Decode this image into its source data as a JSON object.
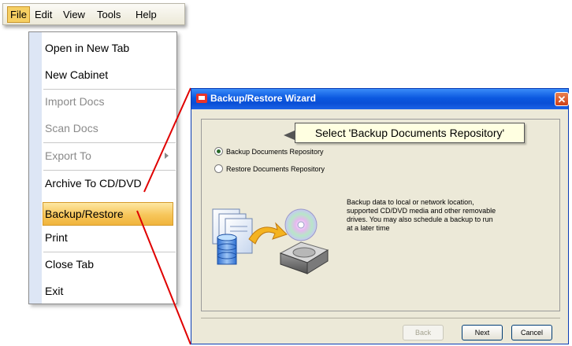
{
  "menubar": {
    "items": [
      "File",
      "Edit",
      "View",
      "Tools",
      "Help"
    ],
    "active": "File"
  },
  "file_menu": {
    "items": [
      {
        "label": "Open in New Tab",
        "enabled": true
      },
      {
        "label": "New Cabinet",
        "enabled": true
      },
      {
        "label": "Import Docs",
        "enabled": false
      },
      {
        "label": "Scan Docs",
        "enabled": false
      },
      {
        "label": "Export To",
        "enabled": false,
        "submenu": true
      },
      {
        "label": "Archive To CD/DVD",
        "enabled": true
      },
      {
        "label": "Backup/Restore",
        "enabled": true,
        "highlighted": true
      },
      {
        "label": "Print",
        "enabled": true
      },
      {
        "label": "Close Tab",
        "enabled": true
      },
      {
        "label": "Exit",
        "enabled": true
      }
    ]
  },
  "wizard": {
    "title": "Backup/Restore Wizard",
    "callout": "Select 'Backup Documents Repository'",
    "options": [
      {
        "label": "Backup Documents Repository",
        "checked": true
      },
      {
        "label": "Restore Documents Repository",
        "checked": false
      }
    ],
    "description": "Backup data to local or network location, supported CD/DVD media and other removable drives.  You may also schedule a backup to run at a later time",
    "buttons": {
      "back": "Back",
      "next": "Next",
      "cancel": "Cancel"
    },
    "close_icon": "close-icon"
  },
  "colors": {
    "menu_highlight": "#f7c65a",
    "titlebar": "#0b58e0",
    "zoom_line": "#e00000"
  }
}
